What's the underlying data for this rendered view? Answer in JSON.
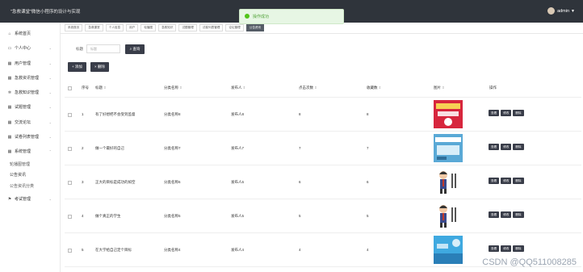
{
  "header": {
    "brand": "\"急救课堂\"微信小程序的设计与实现",
    "toast": "操作成功",
    "user": "admin"
  },
  "sidebar": {
    "items": [
      {
        "label": "系统首页",
        "icon": "home-icon"
      },
      {
        "label": "个人中心",
        "icon": "user-icon"
      },
      {
        "label": "用户管理",
        "icon": "grid-icon"
      },
      {
        "label": "急救资讯管理",
        "icon": "grid-icon"
      },
      {
        "label": "急救知识管理",
        "icon": "gear-icon"
      },
      {
        "label": "试题管理",
        "icon": "grid-icon"
      },
      {
        "label": "交流论坛",
        "icon": "grid-icon"
      },
      {
        "label": "试卷列表管理",
        "icon": "grid-icon"
      },
      {
        "label": "系统管理",
        "icon": "grid-icon"
      }
    ],
    "sub_items": [
      "轮播图管理",
      "公告资讯",
      "公告资讯分类"
    ],
    "last_item": {
      "label": "考试管理",
      "icon": "flag-icon"
    }
  },
  "tabs": [
    "系统首页",
    "急救课堂",
    "个人信息",
    "用户",
    "轮播图",
    "急救知识",
    "试题管理",
    "试卷列表管理",
    "论坛管理",
    "公告资讯"
  ],
  "search": {
    "label": "标题",
    "placeholder": "标题",
    "query_label": "查询"
  },
  "actions": {
    "add_label": "添加",
    "delete_label": "删除"
  },
  "table": {
    "headers": {
      "index": "序号",
      "title": "标题",
      "category": "分类名称",
      "publisher": "发布人",
      "clicks": "点击次数",
      "favorites": "收藏数",
      "image": "图片",
      "operations": "操作"
    },
    "rows": [
      {
        "index": "1",
        "title": "有了好想把不会受到监督",
        "category": "分类名称8",
        "publisher": "发布人8",
        "clicks": "8",
        "favorites": "8",
        "image": "red-poster"
      },
      {
        "index": "2",
        "title": "做一个最好的自己",
        "category": "分类名称7",
        "publisher": "发布人7",
        "clicks": "7",
        "favorites": "7",
        "image": "blue-poster"
      },
      {
        "index": "3",
        "title": "正大的目标是成功的如空",
        "category": "分类名称6",
        "publisher": "发布人6",
        "clicks": "6",
        "favorites": "6",
        "image": "cartoon-man"
      },
      {
        "index": "4",
        "title": "做个真正的学生",
        "category": "分类名称5",
        "publisher": "发布人5",
        "clicks": "5",
        "favorites": "5",
        "image": "cartoon-man"
      },
      {
        "index": "5",
        "title": "在大学给自己定个目标",
        "category": "分类名称4",
        "publisher": "发布人4",
        "clicks": "4",
        "favorites": "4",
        "image": "blue-banner"
      }
    ],
    "row_actions": [
      "查看",
      "修改",
      "删除"
    ]
  },
  "watermark": "CSDN @QQ511008285"
}
